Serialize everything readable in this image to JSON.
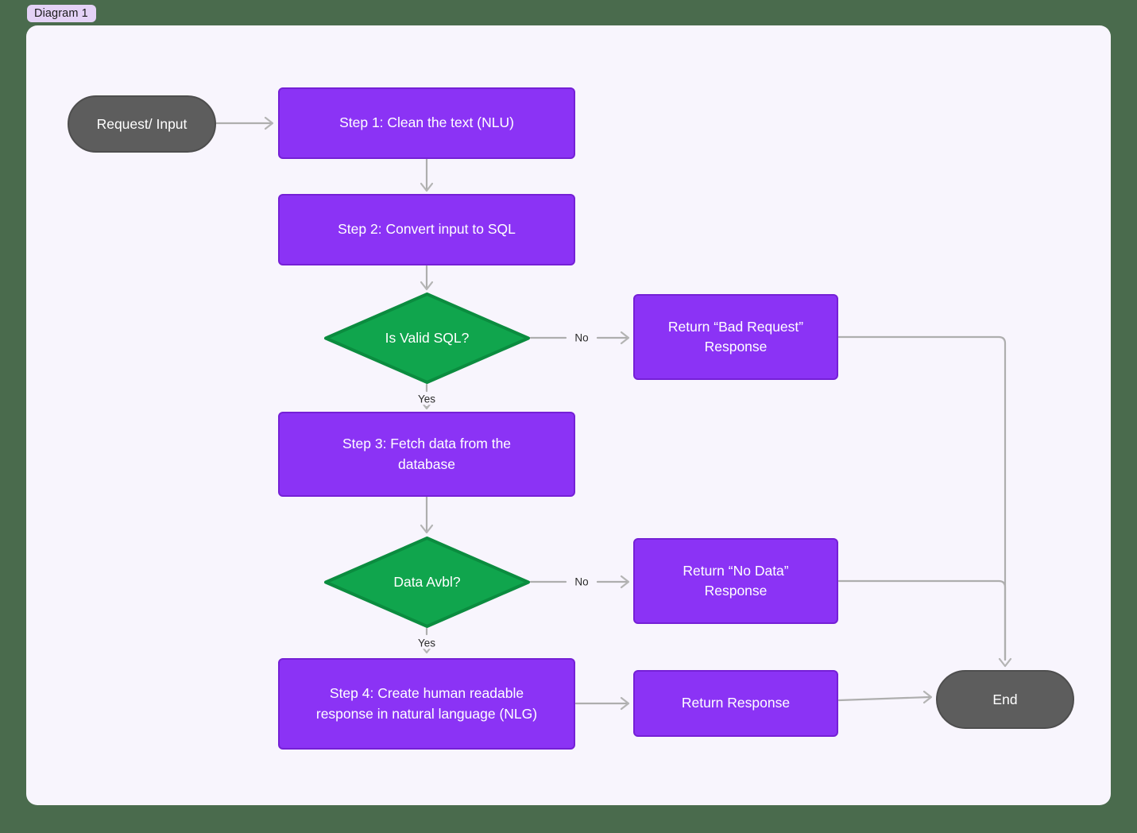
{
  "canvas": {
    "background_color": "#4a6b4d",
    "card_color": "#f8f5fd",
    "tab_label": "Diagram 1",
    "tab_color": "#e4d2f6"
  },
  "palette": {
    "process_fill": "#8b33f5",
    "process_stroke": "#7520d6",
    "decision_fill": "#10a54d",
    "decision_stroke": "#0b8c3f",
    "terminal_fill": "#5d5d5d",
    "terminal_stroke": "#4e4e4e",
    "edge_color": "#aeaeae",
    "node_text": "#ffffff",
    "edge_label_text": "#2b2b2b"
  },
  "nodes": {
    "request_input": {
      "label": "Request/ Input",
      "shape": "terminal"
    },
    "step1": {
      "label": "Step 1: Clean the text (NLU)",
      "shape": "process"
    },
    "step2": {
      "label": "Step 2: Convert input to SQL",
      "shape": "process"
    },
    "valid_sql": {
      "label": "Is Valid SQL?",
      "shape": "decision"
    },
    "bad_request_line1": "Return “Bad Request”",
    "bad_request_line2": "Response",
    "step3_line1": "Step 3: Fetch data from the",
    "step3_line2": "database",
    "data_avbl": {
      "label": "Data Avbl?",
      "shape": "decision"
    },
    "no_data_line1": "Return “No Data”",
    "no_data_line2": "Response",
    "step4_line1": "Step 4: Create human readable",
    "step4_line2": "response in natural language (NLG)",
    "return_response": {
      "label": "Return Response",
      "shape": "process"
    },
    "end": {
      "label": "End",
      "shape": "terminal"
    }
  },
  "edge_labels": {
    "valid_sql_no": "No",
    "valid_sql_yes": "Yes",
    "data_avbl_no": "No",
    "data_avbl_yes": "Yes"
  }
}
